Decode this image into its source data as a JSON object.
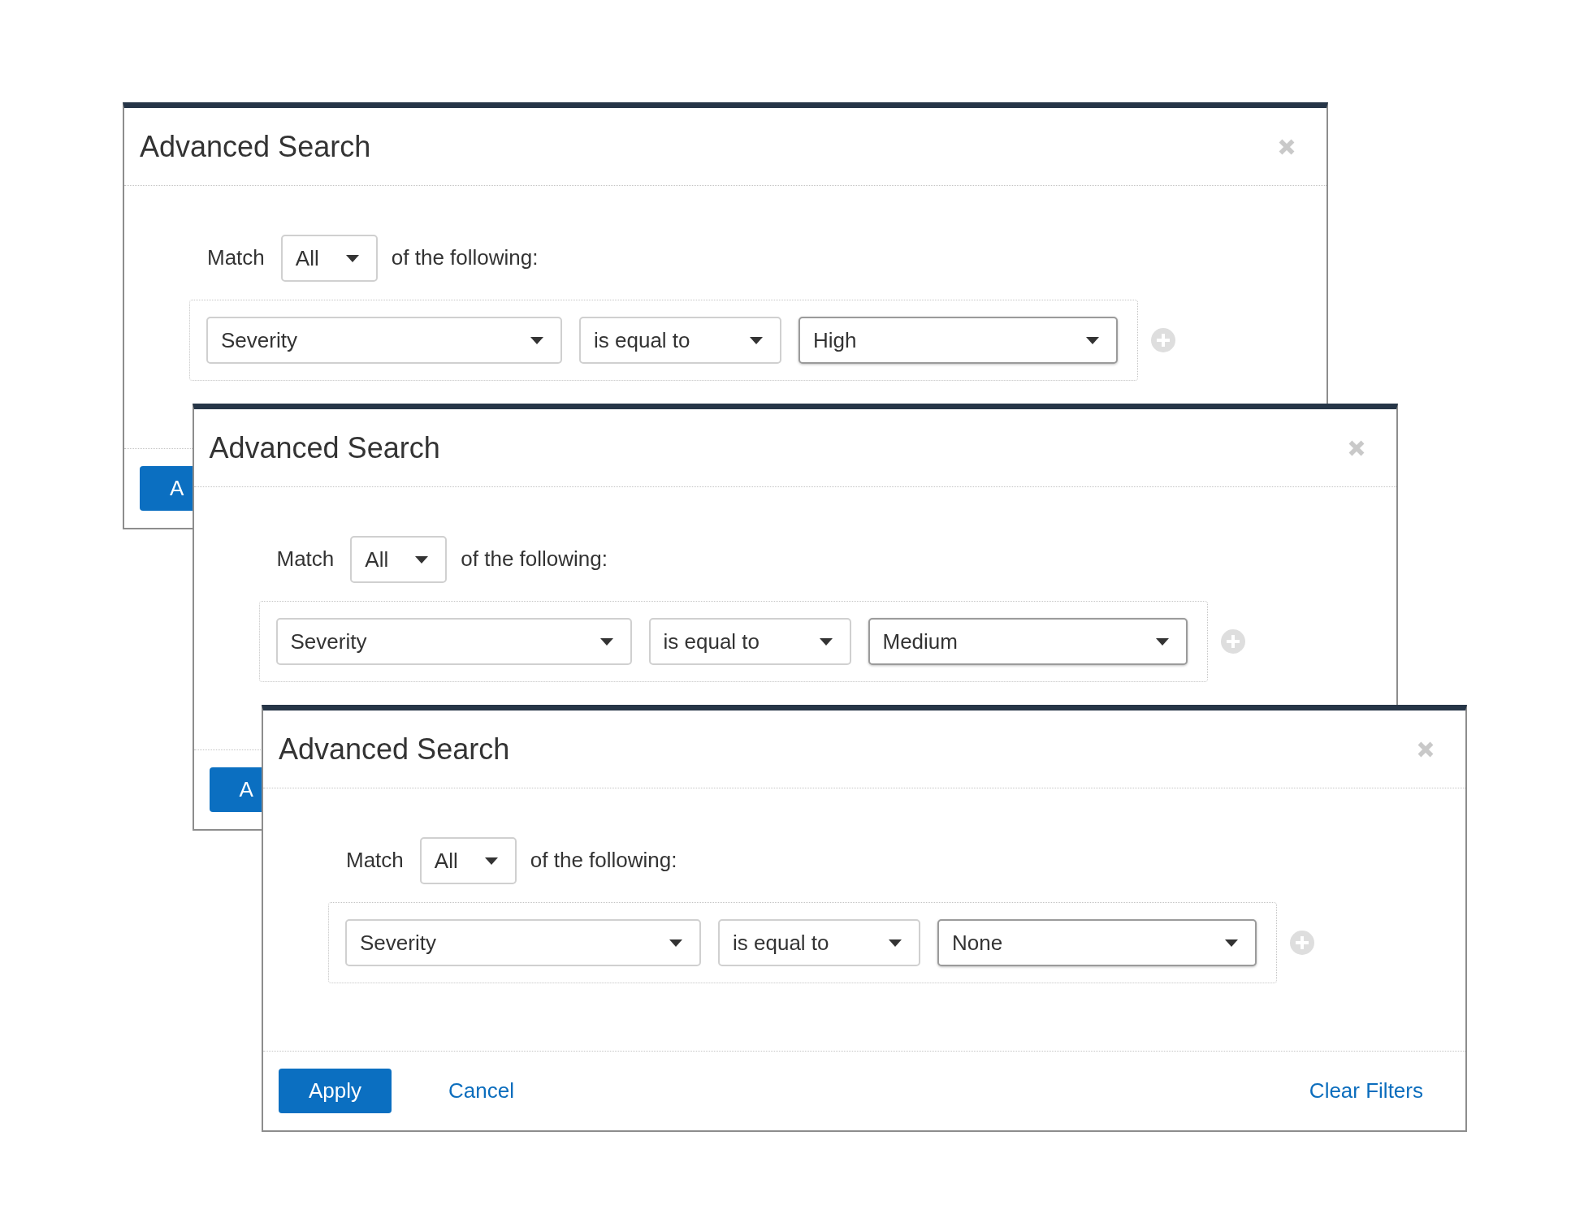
{
  "dialogs": [
    {
      "title": "Advanced Search",
      "match": {
        "label": "Match",
        "value": "All",
        "suffix": "of the following:"
      },
      "rules": [
        {
          "selects": [
            {
              "value": "Severity",
              "highlighted": false
            },
            {
              "value": "is equal to",
              "highlighted": false
            },
            {
              "value": "High",
              "highlighted": true
            }
          ]
        }
      ],
      "footer": {
        "apply": "A"
      }
    },
    {
      "title": "Advanced Search",
      "match": {
        "label": "Match",
        "value": "All",
        "suffix": "of the following:"
      },
      "rules": [
        {
          "selects": [
            {
              "value": "Severity",
              "highlighted": false
            },
            {
              "value": "is equal to",
              "highlighted": false
            },
            {
              "value": "Medium",
              "highlighted": true
            }
          ]
        }
      ],
      "footer": {
        "apply": "A"
      }
    },
    {
      "title": "Advanced Search",
      "match": {
        "label": "Match",
        "value": "All",
        "suffix": "of the following:"
      },
      "rules": [
        {
          "selects": [
            {
              "value": "Severity",
              "highlighted": false
            },
            {
              "value": "is equal to",
              "highlighted": false
            },
            {
              "value": "None",
              "highlighted": true
            }
          ]
        }
      ],
      "footer": {
        "apply": "Apply",
        "cancel": "Cancel",
        "clear_filters": "Clear Filters"
      }
    }
  ]
}
